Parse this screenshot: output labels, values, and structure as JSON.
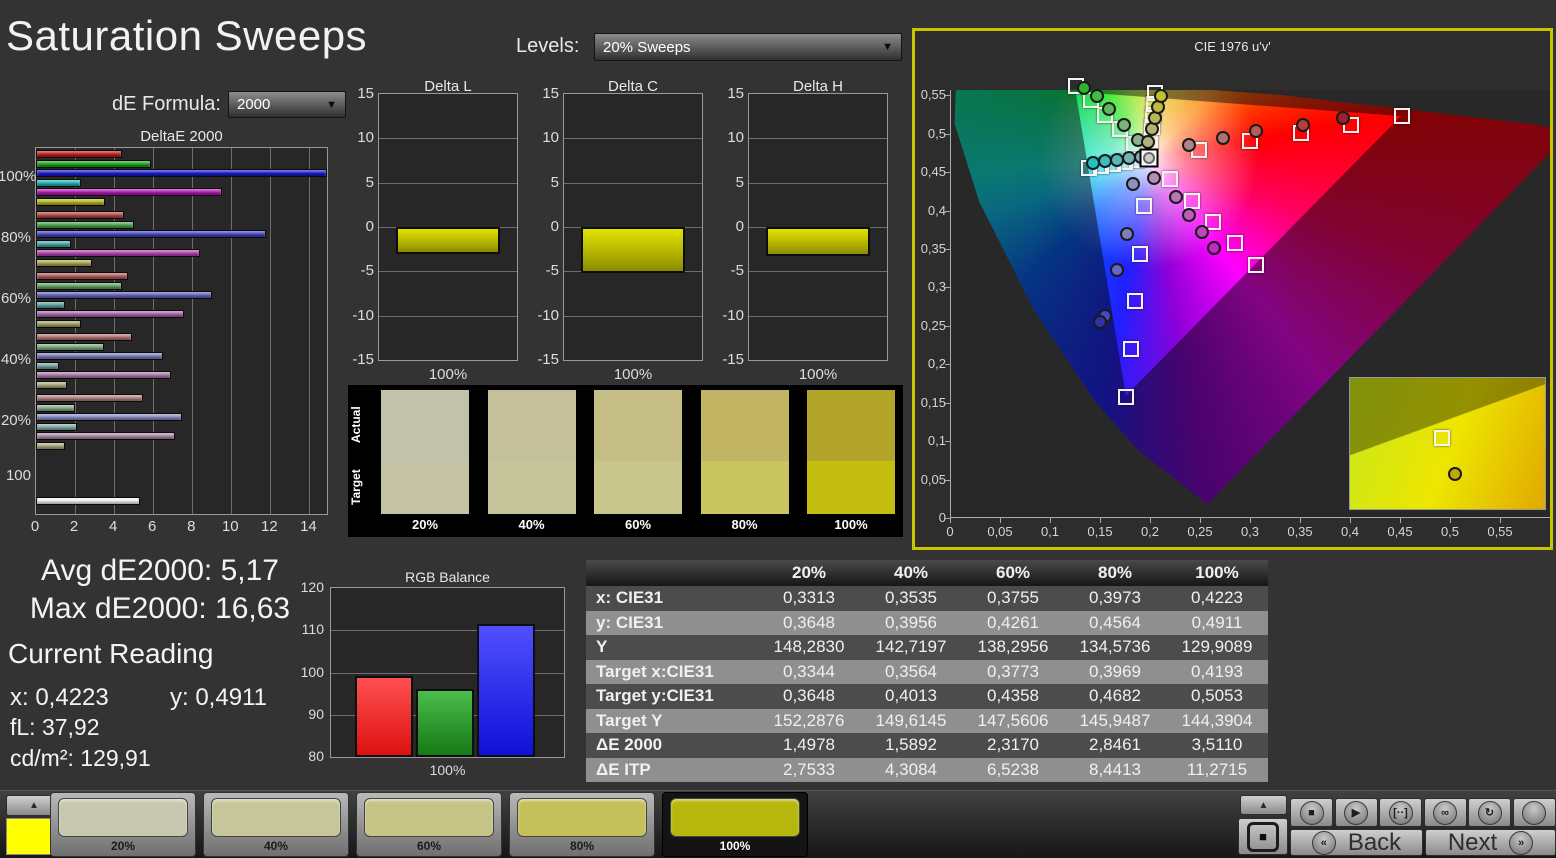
{
  "header": {
    "title": "Saturation Sweeps",
    "de_formula_label": "dE Formula:",
    "de_formula_value": "2000",
    "levels_label": "Levels:",
    "levels_value": "20% Sweeps",
    "dropdown_caret": "▼"
  },
  "stats": {
    "avg": "Avg dE2000: 5,17",
    "max": "Max dE2000: 16,63",
    "current_reading_label": "Current Reading",
    "x": "x: 0,4223",
    "y": "y: 0,4911",
    "fl": "fL: 37,92",
    "cdm2": "cd/m²: 129,91"
  },
  "swatch_strip": {
    "row_labels": [
      "Actual",
      "Target"
    ],
    "columns": [
      {
        "label": "20%",
        "actual": "#c2c2aa",
        "target": "#c4c4a4"
      },
      {
        "label": "40%",
        "actual": "#c3c09a",
        "target": "#c5c59c"
      },
      {
        "label": "60%",
        "actual": "#c5be86",
        "target": "#c8c68a"
      },
      {
        "label": "80%",
        "actual": "#c1b463",
        "target": "#c9c561"
      },
      {
        "label": "100%",
        "actual": "#b2a52a",
        "target": "#c4be11"
      }
    ]
  },
  "chart_data": [
    {
      "id": "deltae2000",
      "type": "bar",
      "orientation": "horizontal",
      "title": "DeltaE 2000",
      "xlim": [
        0,
        14.9
      ],
      "xticks": [
        0,
        2,
        4,
        6,
        8,
        10,
        12,
        14
      ],
      "groups": [
        {
          "label": "100%",
          "colors": [
            "#c01818",
            "#18a018",
            "#1818cc",
            "#18b4b4",
            "#b414b4",
            "#b4b418"
          ],
          "values": [
            4.4,
            5.9,
            16.63,
            2.3,
            9.5,
            3.51
          ]
        },
        {
          "label": "80%",
          "colors": [
            "#b44040",
            "#46a046",
            "#4040c0",
            "#40a8a8",
            "#b040b0",
            "#a8a848"
          ],
          "values": [
            4.5,
            5.0,
            11.8,
            1.8,
            8.4,
            2.85
          ]
        },
        {
          "label": "60%",
          "colors": [
            "#b05858",
            "#60a060",
            "#6060b8",
            "#58a0a0",
            "#a860a8",
            "#a0a060"
          ],
          "values": [
            4.7,
            4.4,
            9.0,
            1.5,
            7.6,
            2.32
          ]
        },
        {
          "label": "40%",
          "colors": [
            "#b07070",
            "#78a878",
            "#7878b8",
            "#70a0a0",
            "#a878a8",
            "#a8a878"
          ],
          "values": [
            4.9,
            3.5,
            6.5,
            1.2,
            6.9,
            1.59
          ]
        },
        {
          "label": "20%",
          "colors": [
            "#b08080",
            "#88a888",
            "#8888c0",
            "#80a8a8",
            "#a888a8",
            "#a8a880"
          ],
          "values": [
            5.5,
            2.0,
            7.5,
            2.1,
            7.1,
            1.5
          ]
        },
        {
          "label": "100",
          "colors": [
            "#f2f2f2"
          ],
          "values": [
            5.3
          ]
        }
      ]
    },
    {
      "id": "delta_l",
      "type": "bar",
      "title": "Delta L",
      "ylim": [
        -15,
        15
      ],
      "yticks": [
        15,
        10,
        5,
        0,
        -5,
        -10,
        -15
      ],
      "categories": [
        "100%"
      ],
      "values": [
        -3.1
      ],
      "bar_color": "#c6c61c"
    },
    {
      "id": "delta_c",
      "type": "bar",
      "title": "Delta C",
      "ylim": [
        -15,
        15
      ],
      "yticks": [
        15,
        10,
        5,
        0,
        -5,
        -10,
        -15
      ],
      "categories": [
        "100%"
      ],
      "values": [
        -5.2
      ],
      "bar_color": "#c6c61c"
    },
    {
      "id": "delta_h",
      "type": "bar",
      "title": "Delta H",
      "ylim": [
        -15,
        15
      ],
      "yticks": [
        15,
        10,
        5,
        0,
        -5,
        -10,
        -15
      ],
      "categories": [
        "100%"
      ],
      "values": [
        -3.3
      ],
      "bar_color": "#c6c61c"
    },
    {
      "id": "rgb_balance",
      "type": "bar",
      "title": "RGB Balance",
      "ylim": [
        80,
        120
      ],
      "yticks": [
        120,
        110,
        100,
        90,
        80
      ],
      "categories": [
        "100%"
      ],
      "series": [
        {
          "name": "Red",
          "value": 99.2,
          "color_top": "#ff5050",
          "color_bot": "#dd1010"
        },
        {
          "name": "Green",
          "value": 96.1,
          "color_top": "#4cbe4c",
          "color_bot": "#157815"
        },
        {
          "name": "Blue",
          "value": 111.5,
          "color_top": "#5050ff",
          "color_bot": "#1010d8"
        }
      ]
    },
    {
      "id": "cie_diagram",
      "type": "scatter",
      "title": "CIE 1976 u'v'",
      "xlim": [
        0,
        0.6
      ],
      "ylim": [
        0,
        0.557
      ],
      "xtick_labels": [
        "0",
        "0,05",
        "0,1",
        "0,15",
        "0,2",
        "0,25",
        "0,3",
        "0,35",
        "0,4",
        "0,45",
        "0,5",
        "0,55"
      ],
      "ytick_labels": [
        "0",
        "0,05",
        "0,1",
        "0,15",
        "0,2",
        "0,25",
        "0,3",
        "0,35",
        "0,4",
        "0,45",
        "0,5",
        "0,55"
      ],
      "tick_step": 0.05,
      "white_point": {
        "target": [
          0.1978,
          0.4683
        ],
        "measured": [
          0.1978,
          0.4683
        ]
      },
      "gamut_triangle": [
        [
          0.4507,
          0.5229
        ],
        [
          0.125,
          0.5625
        ],
        [
          0.1754,
          0.1579
        ]
      ],
      "spokes": [
        {
          "name": "red",
          "targets": [
            [
              0.2484,
              0.4792
            ],
            [
              0.299,
              0.4901
            ],
            [
              0.3495,
              0.5011
            ],
            [
              0.4001,
              0.512
            ],
            [
              0.4507,
              0.5229
            ]
          ],
          "measured": [
            [
              0.238,
              0.486
            ],
            [
              0.272,
              0.494
            ],
            [
              0.305,
              0.503
            ],
            [
              0.352,
              0.512
            ],
            [
              0.392,
              0.52
            ]
          ],
          "dot_colors": [
            "#b08585",
            "#b37070",
            "#b65a5a",
            "#b43c3c",
            "#9c2030"
          ]
        },
        {
          "name": "green",
          "targets": [
            [
              0.1832,
              0.4871
            ],
            [
              0.1687,
              0.506
            ],
            [
              0.1541,
              0.5248
            ],
            [
              0.1396,
              0.5437
            ],
            [
              0.125,
              0.5625
            ]
          ],
          "measured": [
            [
              0.187,
              0.492
            ],
            [
              0.173,
              0.512
            ],
            [
              0.158,
              0.532
            ],
            [
              0.146,
              0.549
            ],
            [
              0.133,
              0.56
            ]
          ],
          "dot_colors": [
            "#8fb08f",
            "#78b478",
            "#5eb85e",
            "#44bc44",
            "#2ab42a"
          ]
        },
        {
          "name": "blue",
          "targets": [
            [
              0.1933,
              0.4062
            ],
            [
              0.1888,
              0.3441
            ],
            [
              0.1844,
              0.2821
            ],
            [
              0.1799,
              0.22
            ],
            [
              0.1754,
              0.1579
            ]
          ],
          "measured": [
            [
              0.182,
              0.435
            ],
            [
              0.176,
              0.37
            ],
            [
              0.166,
              0.323
            ],
            [
              0.154,
              0.263
            ],
            [
              0.149,
              0.255
            ]
          ],
          "dot_colors": [
            "#9090b8",
            "#7c7cc0",
            "#6666c4",
            "#4848c0",
            "#3030a8"
          ]
        },
        {
          "name": "cyan",
          "targets": [
            [
              0.1859,
              0.4657
            ],
            [
              0.174,
              0.4631
            ],
            [
              0.1621,
              0.4606
            ],
            [
              0.1502,
              0.458
            ],
            [
              0.1383,
              0.4554
            ]
          ],
          "measured": [
            [
              0.19,
              0.47
            ],
            [
              0.178,
              0.468
            ],
            [
              0.166,
              0.466
            ],
            [
              0.154,
              0.464
            ],
            [
              0.142,
              0.462
            ]
          ],
          "dot_colors": [
            "#88b0b0",
            "#70b4b4",
            "#58b8b8",
            "#3cbcbc",
            "#22c0c0"
          ]
        },
        {
          "name": "magenta",
          "targets": [
            [
              0.2192,
              0.4406
            ],
            [
              0.2407,
              0.4129
            ],
            [
              0.2621,
              0.3853
            ],
            [
              0.2836,
              0.3576
            ],
            [
              0.305,
              0.3299
            ]
          ],
          "measured": [
            [
              0.203,
              0.442
            ],
            [
              0.225,
              0.418
            ],
            [
              0.238,
              0.394
            ],
            [
              0.251,
              0.372
            ],
            [
              0.263,
              0.351
            ]
          ],
          "dot_colors": [
            "#b08fb0",
            "#b478b4",
            "#b85eb8",
            "#bc44bc",
            "#c428c4"
          ]
        },
        {
          "name": "yellow",
          "targets": [
            [
              0.1994,
              0.4894
            ],
            [
              0.2007,
              0.5085
            ],
            [
              0.2019,
              0.5247
            ],
            [
              0.2029,
              0.5385
            ],
            [
              0.2039,
              0.5529
            ]
          ],
          "measured": [
            [
              0.1974,
              0.4889
            ],
            [
              0.2008,
              0.5057
            ],
            [
              0.204,
              0.5209
            ],
            [
              0.2069,
              0.5347
            ],
            [
              0.2099,
              0.5492
            ]
          ],
          "dot_colors": [
            "#b0b085",
            "#b4b470",
            "#b8b85a",
            "#bcbc40",
            "#c0c028"
          ]
        }
      ],
      "inset": {
        "square_pos_pct": [
          47,
          46
        ],
        "circle_pos_pct": [
          54,
          73
        ],
        "circle_color": "#c0a800"
      }
    },
    {
      "id": "measurement_table",
      "type": "table",
      "columns": [
        "",
        "20%",
        "40%",
        "60%",
        "80%",
        "100%"
      ],
      "rows": [
        {
          "label": "x: CIE31",
          "values": [
            "0,3313",
            "0,3535",
            "0,3755",
            "0,3973",
            "0,4223"
          ]
        },
        {
          "label": "y: CIE31",
          "values": [
            "0,3648",
            "0,3956",
            "0,4261",
            "0,4564",
            "0,4911"
          ]
        },
        {
          "label": "Y",
          "values": [
            "148,2830",
            "142,7197",
            "138,2956",
            "134,5736",
            "129,9089"
          ]
        },
        {
          "label": "Target x:CIE31",
          "values": [
            "0,3344",
            "0,3564",
            "0,3773",
            "0,3969",
            "0,4193"
          ]
        },
        {
          "label": "Target y:CIE31",
          "values": [
            "0,3648",
            "0,4013",
            "0,4358",
            "0,4682",
            "0,5053"
          ]
        },
        {
          "label": "Target Y",
          "values": [
            "152,2876",
            "149,6145",
            "147,5606",
            "145,9487",
            "144,3904"
          ]
        },
        {
          "label": "ΔE 2000",
          "values": [
            "1,4978",
            "1,5892",
            "2,3170",
            "2,8461",
            "3,5110"
          ]
        },
        {
          "label": "ΔE ITP",
          "values": [
            "2,7533",
            "4,3084",
            "6,5238",
            "8,4413",
            "11,2715"
          ]
        }
      ]
    }
  ],
  "bottom_bar": {
    "expander_icon": "▲",
    "active_patch_color": "#ffff00",
    "patches": [
      {
        "label": "20%",
        "color": "#c8c8b0",
        "selected": false
      },
      {
        "label": "40%",
        "color": "#c6c69a",
        "selected": false
      },
      {
        "label": "60%",
        "color": "#c5c386",
        "selected": false
      },
      {
        "label": "80%",
        "color": "#c4c15a",
        "selected": false
      },
      {
        "label": "100%",
        "color": "#b6b60d",
        "selected": true
      }
    ],
    "panel_square_icon": "■",
    "transport": [
      {
        "name": "stop",
        "glyph": "■"
      },
      {
        "name": "play",
        "glyph": "▶"
      },
      {
        "name": "range",
        "glyph": "[··]"
      },
      {
        "name": "loop",
        "glyph": "∞"
      },
      {
        "name": "refresh",
        "glyph": "↻"
      },
      {
        "name": "record",
        "glyph": ""
      }
    ],
    "back": {
      "label": "Back",
      "icon": "«"
    },
    "next": {
      "label": "Next",
      "icon": "»"
    }
  }
}
